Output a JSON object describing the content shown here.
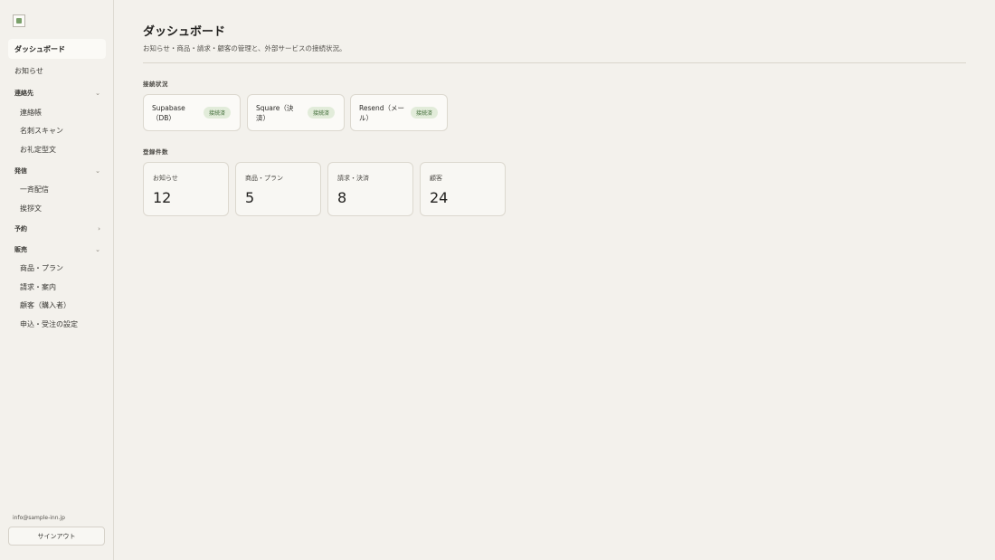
{
  "sidebar": {
    "items": {
      "dashboard": "ダッシュボード",
      "news": "お知らせ"
    },
    "groups": {
      "contacts": {
        "label": "連絡先",
        "items": [
          "連絡帳",
          "名刺スキャン",
          "お礼定型文"
        ]
      },
      "sending": {
        "label": "発信",
        "items": [
          "一斉配信",
          "挨拶文"
        ]
      },
      "booking": {
        "label": "予約"
      },
      "sales": {
        "label": "販売",
        "items": [
          "商品・プラン",
          "請求・案内",
          "顧客（購入者）",
          "申込・受注の設定"
        ]
      }
    },
    "user_email": "info@sample-inn.jp",
    "signout_label": "サインアウト"
  },
  "main": {
    "title": "ダッシュボード",
    "subtitle": "お知らせ・商品・請求・顧客の管理と、外部サービスの接続状況。",
    "connection_section": "接続状況",
    "connections": [
      {
        "name": "Supabase（DB）",
        "status": "接続済"
      },
      {
        "name": "Square（決済）",
        "status": "接続済"
      },
      {
        "name": "Resend（メール）",
        "status": "接続済"
      }
    ],
    "counts_section": "登録件数",
    "stats": [
      {
        "label": "お知らせ",
        "value": "12"
      },
      {
        "label": "商品・プラン",
        "value": "5"
      },
      {
        "label": "請求・決済",
        "value": "8"
      },
      {
        "label": "顧客",
        "value": "24"
      }
    ]
  },
  "icons": {
    "expanded": "chevron-down-icon",
    "collapsed": "chevron-right-icon",
    "logo": "broken-image-icon"
  },
  "colors": {
    "background": "#f3f1ec",
    "card": "#fbfaf7",
    "badge_bg": "#e2ecda",
    "badge_text": "#3f6b37"
  }
}
